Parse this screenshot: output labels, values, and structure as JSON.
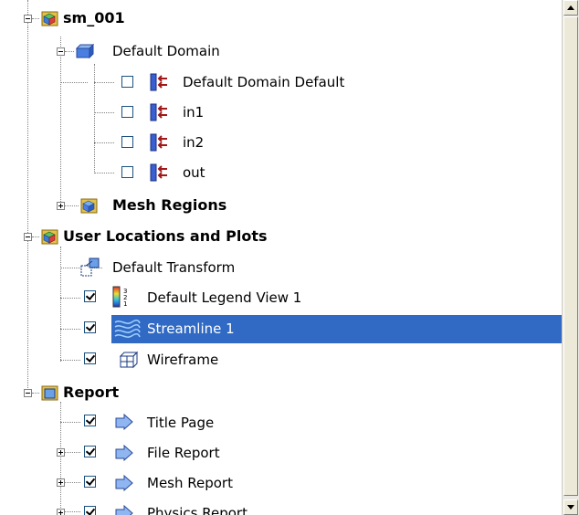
{
  "tree": {
    "sm_001": {
      "label": "sm_001",
      "icon": "case-cube-icon"
    },
    "default_domain": {
      "label": "Default Domain",
      "icon": "domain-box-icon"
    },
    "boundaries": [
      {
        "label": "Default Domain Default",
        "checked": false,
        "icon": "boundary-icon"
      },
      {
        "label": "in1",
        "checked": false,
        "icon": "boundary-icon"
      },
      {
        "label": "in2",
        "checked": false,
        "icon": "boundary-icon"
      },
      {
        "label": "out",
        "checked": false,
        "icon": "boundary-icon"
      }
    ],
    "mesh_regions": {
      "label": "Mesh Regions",
      "icon": "folder-cube-icon"
    },
    "user_locations": {
      "label": "User Locations and Plots",
      "icon": "folder-cube-icon"
    },
    "user_items": [
      {
        "label": "Default Transform",
        "icon": "transform-icon"
      },
      {
        "label": "Default Legend View 1",
        "checked": true,
        "icon": "legend-icon"
      },
      {
        "label": "Streamline 1",
        "checked": true,
        "icon": "streamline-icon",
        "selected": true
      },
      {
        "label": "Wireframe",
        "checked": true,
        "icon": "wireframe-icon"
      }
    ],
    "report": {
      "label": "Report",
      "icon": "report-folder-icon"
    },
    "report_items": [
      {
        "label": "Title Page",
        "checked": true,
        "icon": "report-page-icon"
      },
      {
        "label": "File Report",
        "checked": true,
        "icon": "report-page-icon"
      },
      {
        "label": "Mesh Report",
        "checked": true,
        "icon": "report-page-icon"
      },
      {
        "label": "Physics Report",
        "checked": true,
        "icon": "report-page-icon"
      }
    ]
  },
  "colors": {
    "selection": "#316ac5",
    "boundary_blue": "#3a5fd0",
    "boundary_arrow": "#a01818"
  }
}
